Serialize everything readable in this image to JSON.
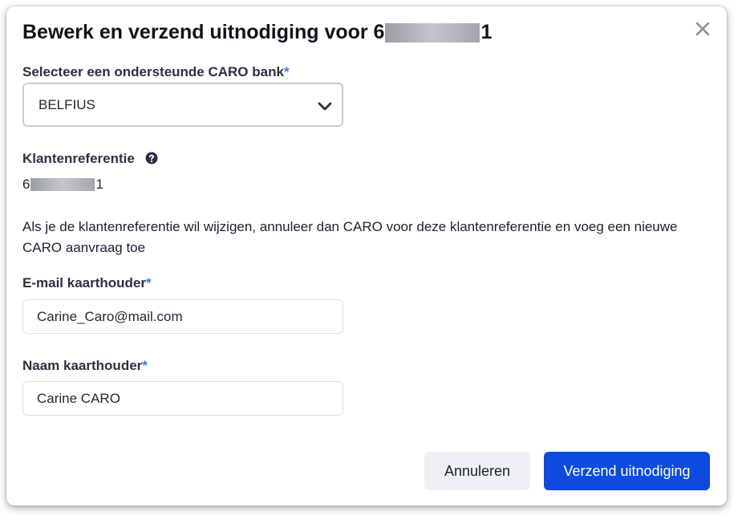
{
  "dialog": {
    "title_prefix": "Bewerk en verzend uitnodiging voor 6",
    "title_suffix": "1"
  },
  "bank": {
    "label": "Selecteer een ondersteunde CARO bank",
    "required_mark": "*",
    "selected": "BELFIUS"
  },
  "reference": {
    "label": "Klantenreferentie",
    "value_prefix": "6",
    "value_suffix": "1"
  },
  "info_text": "Als je de klantenreferentie wil wijzigen, annuleer dan CARO voor deze klantenreferentie en voeg een nieuwe CARO aanvraag toe",
  "email": {
    "label": "E-mail kaarthouder",
    "required_mark": "*",
    "value": "Carine_Caro@mail.com"
  },
  "name": {
    "label": "Naam kaarthouder",
    "required_mark": "*",
    "value": "Carine CARO"
  },
  "buttons": {
    "cancel": "Annuleren",
    "send": "Verzend uitnodiging"
  },
  "colors": {
    "primary": "#0c4ae0",
    "required": "#3b7bea",
    "secondary_button": "#eef0f4"
  }
}
